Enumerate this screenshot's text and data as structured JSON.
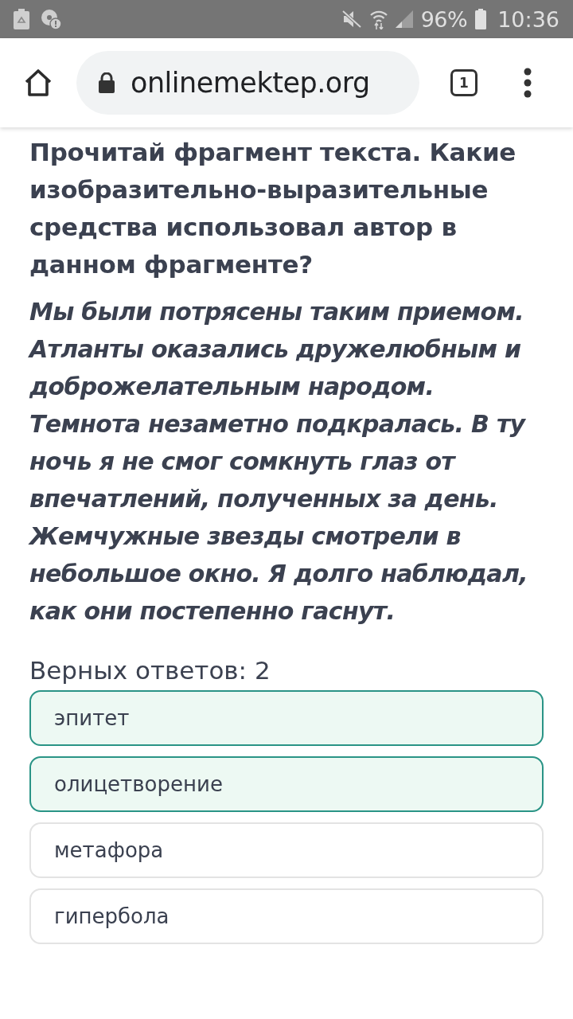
{
  "status_bar": {
    "battery": "96%",
    "time": "10:36"
  },
  "browser": {
    "url": "onlinemektep.org",
    "tab_count": "1"
  },
  "question": {
    "prompt": "Прочитай фрагмент текста. Какие изобразительно-выразительные средства использовал автор в данном фрагменте?",
    "passage": "Мы были потрясены таким приемом. Атланты оказались дружелюбным и доброжелательным народом. Темнота незаметно подкралась. В ту ночь я не смог сомкнуть глаз от впечатлений, полученных за день. Жемчужные звезды смотрели в небольшое окно. Я долго наблюдал, как они постепенно гаснут.",
    "answer_count": "Верных ответов: 2",
    "options": [
      {
        "label": "эпитет",
        "selected": true
      },
      {
        "label": "олицетворение",
        "selected": true
      },
      {
        "label": "метафора",
        "selected": false
      },
      {
        "label": "гипербола",
        "selected": false
      }
    ]
  }
}
